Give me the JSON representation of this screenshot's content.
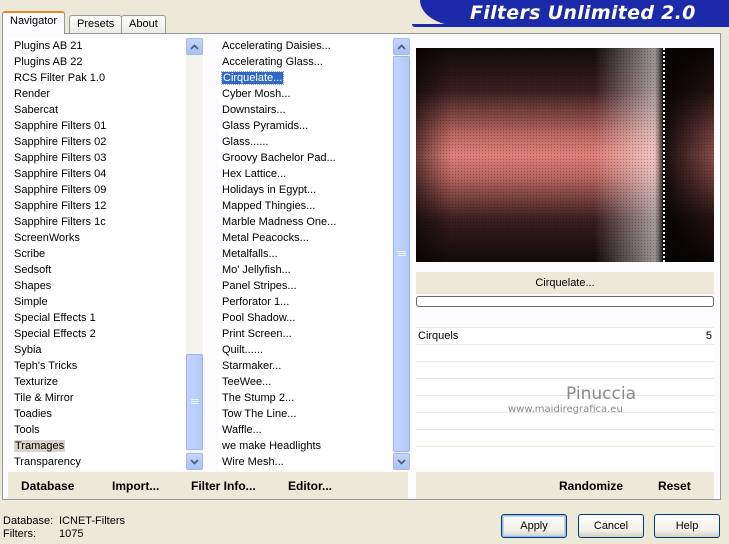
{
  "tabs": [
    {
      "label": "Navigator",
      "active": true
    },
    {
      "label": "Presets",
      "active": false
    },
    {
      "label": "About",
      "active": false
    }
  ],
  "banner_title": "Filters Unlimited 2.0",
  "categories": [
    "Plugins AB 21",
    "Plugins AB 22",
    "RCS Filter Pak 1.0",
    "Render",
    "Sabercat",
    "Sapphire Filters 01",
    "Sapphire Filters 02",
    "Sapphire Filters 03",
    "Sapphire Filters 04",
    "Sapphire Filters 09",
    "Sapphire Filters 12",
    "Sapphire Filters 1c",
    "ScreenWorks",
    "Scribe",
    "Sedsoft",
    "Shapes",
    "Simple",
    "Special Effects 1",
    "Special Effects 2",
    "Sybia",
    "Teph's Tricks",
    "Texturize",
    "Tile & Mirror",
    "Toadies",
    "Tools",
    "Tramages",
    "Transparency"
  ],
  "selected_category": "Tramages",
  "filters": [
    "Accelerating Daisies...",
    "Accelerating Glass...",
    "Cirquelate...",
    "Cyber Mosh...",
    "Downstairs...",
    "Glass Pyramids...",
    "Glass......",
    "Groovy Bachelor Pad...",
    "Hex Lattice...",
    "Holidays in Egypt...",
    "Mapped Thingies...",
    "Marble Madness One...",
    "Metal Peacocks...",
    "Metalfalls...",
    "Mo' Jellyfish...",
    "Panel Stripes...",
    "Perforator 1...",
    "Pool Shadow...",
    "Print Screen...",
    "Quilt......",
    "Starmaker...",
    "TeeWee...",
    "The Stump 2...",
    "Tow The Line...",
    "Waffle...",
    "we make Headlights",
    "Wire Mesh..."
  ],
  "selected_filter": "Cirquelate...",
  "current_filter_label": "Cirquelate...",
  "progress": 0,
  "params": [
    {
      "name": "Cirquels",
      "value": "5"
    }
  ],
  "watermark": {
    "name": "Pinuccia",
    "url": "www.maidiregrafica.eu"
  },
  "buttons": {
    "database": "Database",
    "import": "Import...",
    "filter_info": "Filter Info...",
    "editor": "Editor...",
    "randomize": "Randomize",
    "reset": "Reset",
    "apply": "Apply",
    "cancel": "Cancel",
    "help": "Help"
  },
  "status": {
    "database_label": "Database:",
    "database_value": "ICNET-Filters",
    "filters_label": "Filters:",
    "filters_value": "1075"
  },
  "colors": {
    "accent_blue": "#1a2aa8",
    "selection": "#316ac5",
    "preview_pink": "#e07d78"
  }
}
